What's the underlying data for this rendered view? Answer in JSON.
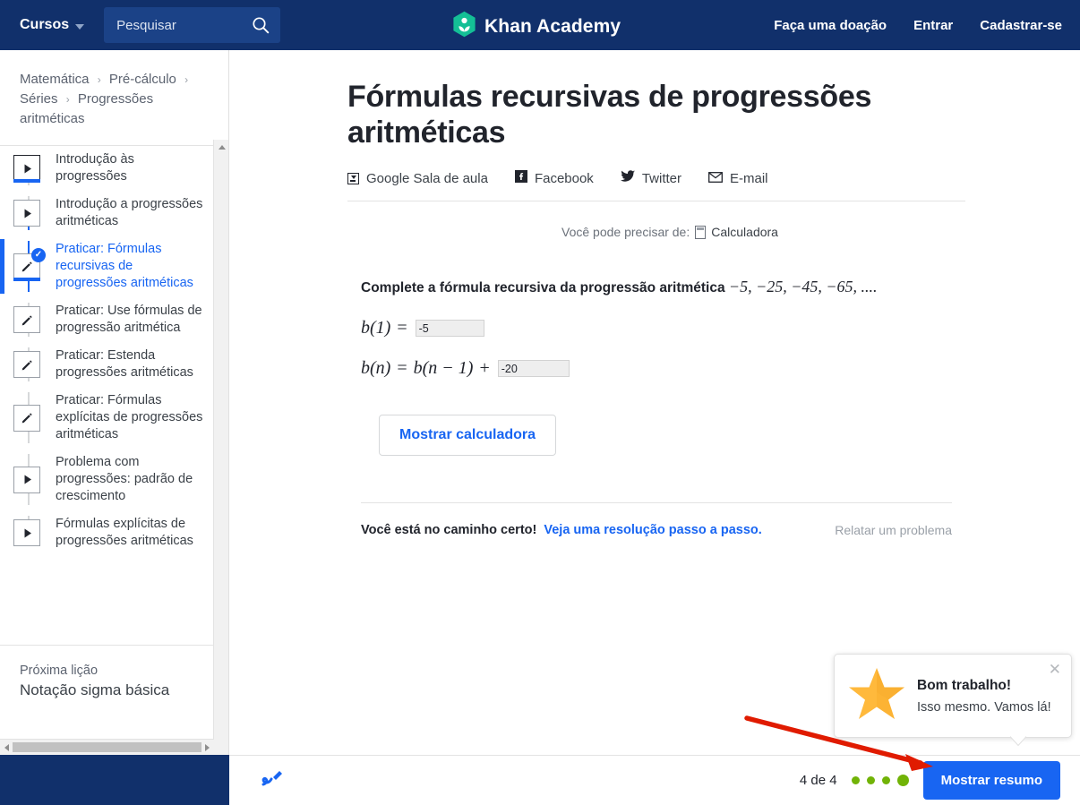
{
  "header": {
    "courses_label": "Cursos",
    "search_placeholder": "Pesquisar",
    "search_value": "",
    "brand_name": "Khan Academy",
    "donate_label": "Faça uma doação",
    "login_label": "Entrar",
    "signup_label": "Cadastrar-se",
    "background_color": "#11306b"
  },
  "breadcrumb": {
    "items": [
      "Matemática",
      "Pré-cálculo",
      "Séries",
      "Progressões aritméticas"
    ],
    "separator": "›"
  },
  "sidebar": {
    "lessons": [
      {
        "label": "Introdução às progressões",
        "icon": "play-icon",
        "state": "in-progress"
      },
      {
        "label": "Introdução a progressões aritméticas",
        "icon": "play-icon",
        "state": "default"
      },
      {
        "label": "Praticar: Fórmulas recursivas de progressões aritméticas",
        "icon": "pencil-icon",
        "state": "active-completed"
      },
      {
        "label": "Praticar: Use fórmulas de progressão aritmética",
        "icon": "pencil-icon",
        "state": "default"
      },
      {
        "label": "Praticar: Estenda progressões aritméticas",
        "icon": "pencil-icon",
        "state": "default"
      },
      {
        "label": "Praticar: Fórmulas explícitas de progressões aritméticas",
        "icon": "pencil-icon",
        "state": "default"
      },
      {
        "label": "Problema com progressões: padrão de crescimento",
        "icon": "play-icon",
        "state": "default"
      },
      {
        "label": "Fórmulas explícitas de progressões aritméticas",
        "icon": "play-icon",
        "state": "default"
      }
    ],
    "next_lesson_kicker": "Próxima lição",
    "next_lesson_title": "Notação sigma básica",
    "active_color": "#1865f2"
  },
  "main": {
    "title": "Fórmulas recursivas de progressões aritméticas",
    "share": [
      {
        "label": "Google Sala de aula",
        "icon": "google-classroom-icon"
      },
      {
        "label": "Facebook",
        "icon": "facebook-icon"
      },
      {
        "label": "Twitter",
        "icon": "twitter-icon"
      },
      {
        "label": "E-mail",
        "icon": "email-icon"
      }
    ],
    "calculator_hint_prefix": "Você pode precisar de:",
    "calculator_link": "Calculadora",
    "question_text": "Complete a fórmula recursiva da progressão aritmética",
    "question_sequence": "−5, −25, −45, −65, ....",
    "equation_1": {
      "lhs": "b(1)",
      "op": "=",
      "answer": "-5"
    },
    "equation_2": {
      "lhs": "b(n)",
      "op": "=",
      "rhs": "b(n − 1)",
      "plus": "+",
      "answer": "-20"
    },
    "calculator_button": "Mostrar calculadora",
    "feedback_message": "Você está no caminho certo!",
    "feedback_link": "Veja uma resolução passo a passo.",
    "report_link": "Relatar um problema"
  },
  "bottom_bar": {
    "scratchpad_icon": "scratchpad-icon",
    "progress_count": "4 de 4",
    "dots_total": 4,
    "dots_color": "#71b307",
    "summary_button": "Mostrar resumo",
    "summary_button_color": "#1865f2"
  },
  "popup": {
    "title": "Bom trabalho!",
    "subtitle": "Isso mesmo. Vamos lá!",
    "icon": "star-icon",
    "close_icon": "close-icon",
    "star_color": "#ffb93c"
  },
  "annotation": {
    "arrow_color": "#e01b00",
    "points_to": "Mostrar resumo"
  }
}
